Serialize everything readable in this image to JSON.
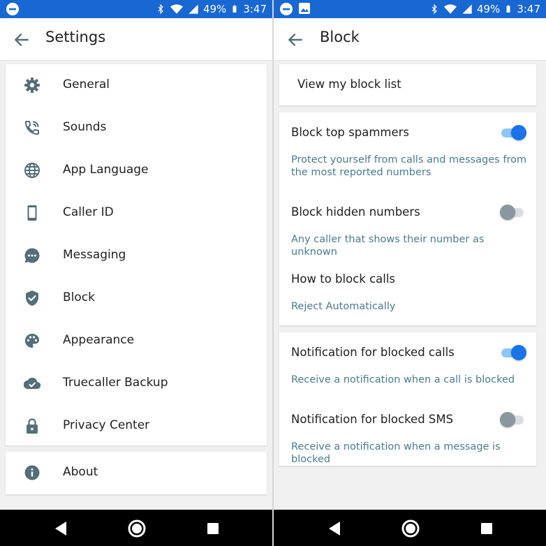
{
  "status": {
    "battery": "49%",
    "time": "3:47"
  },
  "settings": {
    "title": "Settings",
    "items": [
      {
        "label": "General",
        "icon": "gear-icon"
      },
      {
        "label": "Sounds",
        "icon": "phone-ring-icon"
      },
      {
        "label": "App Language",
        "icon": "globe-icon"
      },
      {
        "label": "Caller ID",
        "icon": "smartphone-icon"
      },
      {
        "label": "Messaging",
        "icon": "chat-bubble-icon"
      },
      {
        "label": "Block",
        "icon": "shield-check-icon"
      },
      {
        "label": "Appearance",
        "icon": "palette-icon"
      },
      {
        "label": "Truecaller Backup",
        "icon": "cloud-check-icon"
      },
      {
        "label": "Privacy Center",
        "icon": "lock-icon"
      }
    ],
    "about": {
      "label": "About",
      "icon": "info-icon"
    }
  },
  "block": {
    "title": "Block",
    "view_list": "View my block list",
    "options": [
      {
        "title": "Block top spammers",
        "subtitle": "Protect yourself from calls and messages from the most reported numbers",
        "enabled": true
      },
      {
        "title": "Block hidden numbers",
        "subtitle": "Any caller that shows their number as unknown",
        "enabled": false
      },
      {
        "title": "How to block calls",
        "subtitle": "Reject Automatically"
      },
      {
        "title": "Notification for blocked calls",
        "subtitle": "Receive a notification when a call is blocked",
        "enabled": true
      },
      {
        "title": "Notification for blocked SMS",
        "subtitle": "Receive a notification when a message is blocked",
        "enabled": false
      }
    ]
  },
  "colors": {
    "status_bar": "#1967d2",
    "accent": "#1a73e8",
    "subtitle": "#4b7b8e",
    "icon": "#546e7a"
  }
}
